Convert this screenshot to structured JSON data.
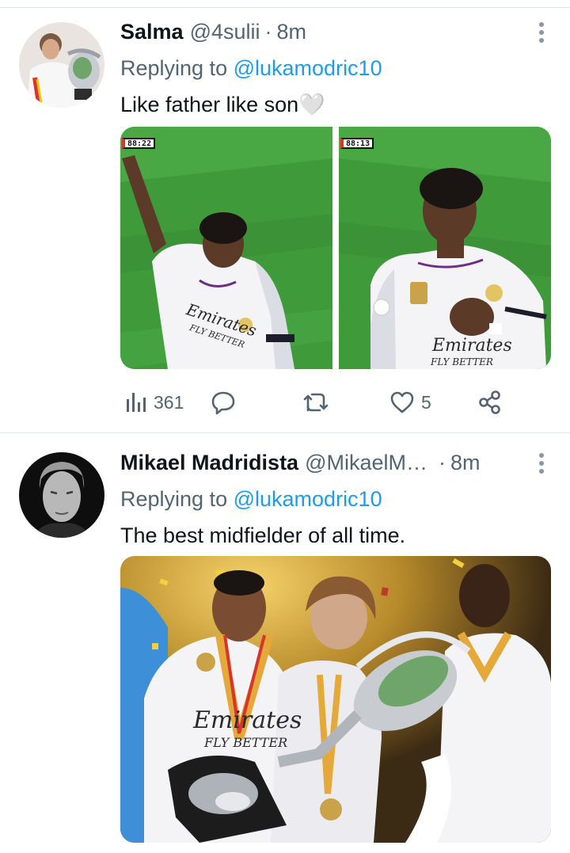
{
  "tweets": [
    {
      "name": "Salma",
      "handle": "@4sulii",
      "separator": "·",
      "time": "8m",
      "reply_prefix": "Replying to",
      "reply_handle": "@lukamodric10",
      "text": "Like father like son🤍",
      "media": [
        {
          "scoreboard": "88:22",
          "shirt_text": "Emirates",
          "shirt_sub": "FLY BETTER"
        },
        {
          "scoreboard": "88:13",
          "shirt_text": "Emirates",
          "shirt_sub": "FLY BETTER"
        }
      ],
      "actions": {
        "views_icon": "bar-chart-icon",
        "views": "361",
        "reply_icon": "speech-bubble-icon",
        "retweet_icon": "retweet-icon",
        "like_icon": "heart-icon",
        "likes": "5",
        "share_icon": "share-icon"
      }
    },
    {
      "name": "Mikael Madridista",
      "handle": "@MikaelM…",
      "separator": "·",
      "time": "8m",
      "reply_prefix": "Replying to",
      "reply_handle": "@lukamodric10",
      "text": "The best midfielder of all time.",
      "media": [
        {
          "shirt_text": "Emirates",
          "shirt_sub": "FLY BETTER"
        }
      ]
    }
  ],
  "colors": {
    "link": "#1d9bf0",
    "secondary_text": "#536471",
    "primary_text": "#0f1419",
    "divider": "#e1e6ea",
    "pitch_green": "#3f9a3a",
    "kit_white": "#f4f4f6"
  }
}
